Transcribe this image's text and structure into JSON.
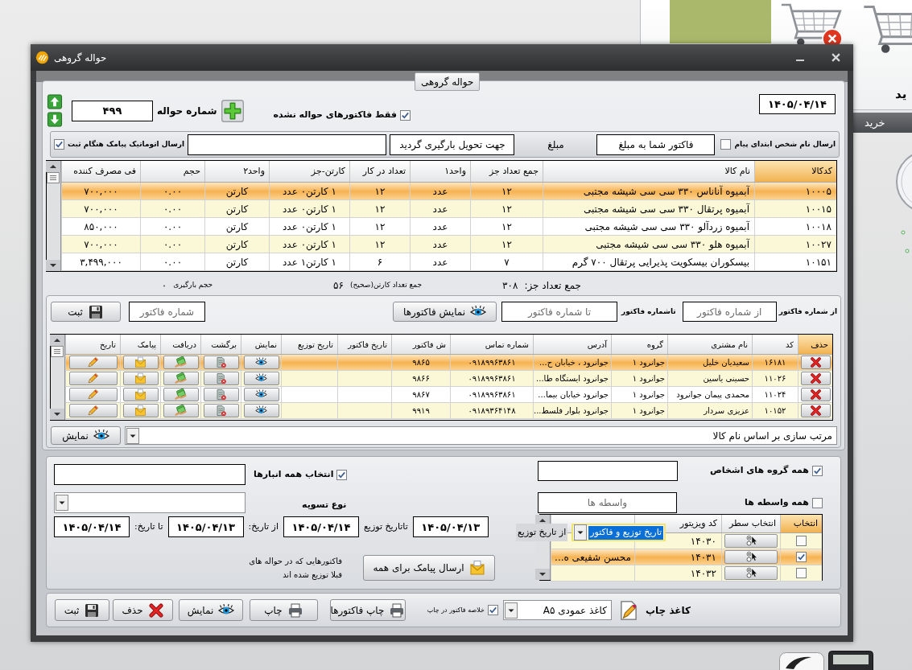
{
  "window": {
    "title": "حواله گروهی",
    "group_title": "حواله گروهی"
  },
  "header": {
    "voucher_label": "شماره حواله",
    "voucher_number": "۴۹۹",
    "unvouchered_only": {
      "label": "فقط فاکتورهای حواله نشده",
      "checked": true
    },
    "date": "۱۴۰۵/۰۴/۱۴"
  },
  "sms": {
    "name_first": {
      "label": "ارسال نام شخص ابتدای پیام",
      "checked": false
    },
    "message_start": "فاکتور شما به مبلغ",
    "amount_label": "مبلغ",
    "message_end": "جهت تحویل بارگیری گردید",
    "auto_send": {
      "label": "ارسال اتوماتیک پیامک هنگام ثبت",
      "checked": true
    }
  },
  "products": {
    "columns": [
      {
        "label": "کدکالا",
        "selected": true
      },
      {
        "label": "نام کالا",
        "selected": false
      },
      {
        "label": "جمع تعداد جز",
        "selected": false
      },
      {
        "label": "واحد۱",
        "selected": false
      },
      {
        "label": "تعداد در کار",
        "selected": false
      },
      {
        "label": "کارتن-جز",
        "selected": false
      },
      {
        "label": "واحد۲",
        "selected": false
      },
      {
        "label": "حجم",
        "selected": false
      },
      {
        "label": "فی مصرف کننده",
        "selected": false
      }
    ],
    "rows": [
      {
        "selected": true,
        "cells": [
          "۱۰۰۰۵",
          "آبمیوه آناناس ۳۳۰ سی سی شیشه مجتبی",
          "۱۲",
          "عدد",
          "۱۲",
          "۱ کارتن۰ عدد",
          "کارتن",
          "۰.۰۰",
          "۷۰۰,۰۰۰"
        ]
      },
      {
        "selected": false,
        "cells": [
          "۱۰۰۱۵",
          "آبمیوه پرتقال ۳۳۰ سی سی شیشه مجتبی",
          "۱۲",
          "عدد",
          "۱۲",
          "۱ کارتن۰ عدد",
          "کارتن",
          "۰.۰۰",
          "۷۰۰,۰۰۰"
        ]
      },
      {
        "selected": false,
        "cells": [
          "۱۰۰۱۸",
          "آبمیوه زردآلو ۳۳۰ سی سی شیشه مجتبی",
          "۱۲",
          "عدد",
          "۱۲",
          "۱ کارتن۰ عدد",
          "کارتن",
          "۰.۰۰",
          "۸۵۰,۰۰۰"
        ]
      },
      {
        "selected": false,
        "cells": [
          "۱۰۰۲۷",
          "آبمیوه هلو ۳۳۰ سی سی شیشه مجتبی",
          "۱۲",
          "عدد",
          "۱۲",
          "۱ کارتن۰ عدد",
          "کارتن",
          "۰.۰۰",
          "۷۰۰,۰۰۰"
        ]
      },
      {
        "selected": false,
        "cells": [
          "۱۰۱۵۱",
          "بیسکوران بیسکویت پذیرایی پرتقال ۷۰۰ گرم",
          "۷",
          "عدد",
          "۶",
          "۱ کارتن۱ عدد",
          "کارتن",
          "۰.۰۰",
          "۳,۴۹۹,۰۰۰"
        ]
      }
    ]
  },
  "totals": [
    {
      "label": "جمع تعداد جز:",
      "value": "۳۰۸"
    },
    {
      "label": "جمع تعداد کارتن(صحیح)",
      "value": "۵۶"
    },
    {
      "label": "حجم بارگیری",
      "value": "۰"
    }
  ],
  "invoices": {
    "from_label": "از شماره فاکتور",
    "from_placeholder": "از شماره فاکتور",
    "to_label": "تاشماره فاکتور",
    "to_placeholder": "تا شماره فاکتور",
    "show_button": "نمایش فاکتورها",
    "number_placeholder": "شماره فاکتور",
    "save_button": "ثبت",
    "columns": [
      {
        "label": "حذف",
        "selected": true
      },
      {
        "label": "کد",
        "selected": false
      },
      {
        "label": "نام مشتری",
        "selected": false
      },
      {
        "label": "گروه",
        "selected": false
      },
      {
        "label": "آدرس",
        "selected": false
      },
      {
        "label": "شماره تماس",
        "selected": false
      },
      {
        "label": "ش فاکتور",
        "selected": false
      },
      {
        "label": "تاریخ فاکتور",
        "selected": false
      },
      {
        "label": "تاریخ توزیع",
        "selected": false
      },
      {
        "label": "نمایش",
        "selected": false
      },
      {
        "label": "برگشت",
        "selected": false
      },
      {
        "label": "دریافت",
        "selected": false
      },
      {
        "label": "پیامک",
        "selected": false
      },
      {
        "label": "تاریخ",
        "selected": false
      }
    ],
    "rows": [
      {
        "selected": true,
        "cells": [
          "",
          "۱۶۱۸۱",
          "سعیدیان خلیل",
          "جوانرود ۱",
          "جوانرود ، خیابان ح...",
          "۰۹۱۸۹۹۶۳۸۶۱",
          "۹۸۶۵"
        ]
      },
      {
        "selected": false,
        "cells": [
          "",
          "۱۱۰۲۶",
          "حسینی یاسین",
          "جوانرود ۱",
          "جوانرود ایستگاه طا...",
          "۰۹۱۸۹۹۶۳۸۶۱",
          "۹۸۶۶"
        ]
      },
      {
        "selected": false,
        "cells": [
          "",
          "۱۱۰۲۴",
          "محمدی پیمان جوانرود",
          "جوانرود ۱",
          "جوانرود خیابان بیما...",
          "۰۹۱۸۹۹۶۳۸۶۱",
          "۹۸۶۷"
        ]
      },
      {
        "selected": false,
        "cells": [
          "",
          "۱۰۱۵۲",
          "عزیزی سردار",
          "جوانرود ۱",
          "جوانرود بلوار فلسط...",
          "۰۹۱۸۹۳۶۴۱۴۸",
          "۹۹۱۹"
        ]
      }
    ],
    "sort": "مرتب سازی بر اساس نام کالا",
    "view_button": "نمایش"
  },
  "filters": {
    "all_person_groups": {
      "label": "همه گروه های اشخاص",
      "checked": true
    },
    "all_brokers": {
      "label": "همه واسطه ها",
      "checked": false
    },
    "broker_placeholder": "واسطه ها",
    "all_warehouses": {
      "label": "انتخاب همه انبارها",
      "checked": true
    },
    "settlement_label": "نوع تسویه",
    "dates": [
      {
        "label": "از تاریخ توزیع",
        "value": "۱۴۰۵/۰۴/۱۳"
      },
      {
        "label": "تاتاریخ توزیع",
        "value": "۱۴۰۵/۰۴/۱۴"
      },
      {
        "label": "از تاریخ:",
        "value": "۱۴۰۵/۰۴/۱۳"
      },
      {
        "label": "تا تاریخ:",
        "value": "۱۴۰۵/۰۴/۱۴"
      }
    ],
    "date_type": "تاریخ توزیع و فاکتور",
    "note": "فاکتورهایی که در حواله های قبلا توزیع شده اند",
    "sms_all_button": "ارسال پیامک برای همه",
    "visitors": {
      "columns": [
        {
          "label": "انتخاب",
          "selected": true
        },
        {
          "label": "انتخاب سطر",
          "selected": false
        },
        {
          "label": "کد ویزیتور",
          "selected": false
        }
      ],
      "rows": [
        {
          "checked": false,
          "selected": false,
          "code": "۱۴۰۳۰"
        },
        {
          "checked": true,
          "selected": true,
          "code": "۱۴۰۳۱",
          "name": "محسن شفیعی ه..."
        },
        {
          "checked": false,
          "selected": false,
          "code": "۱۴۰۳۲"
        }
      ]
    }
  },
  "print": {
    "paper_label": "کاغذ چاپ",
    "paper": "کاغذ عمودی A۵",
    "summary": {
      "label": "خلاصه فاکتور در چاپ",
      "checked": true
    },
    "buttons": [
      {
        "kind": "print",
        "label": "چاپ فاکتورها"
      },
      {
        "kind": "print",
        "label": "چاپ"
      },
      {
        "kind": "view",
        "label": "نمایش"
      },
      {
        "kind": "delete",
        "label": "حذف"
      },
      {
        "kind": "save",
        "label": "ثبت"
      }
    ]
  },
  "background": {
    "menu_label": "ید",
    "menu_tab": "خرید"
  }
}
